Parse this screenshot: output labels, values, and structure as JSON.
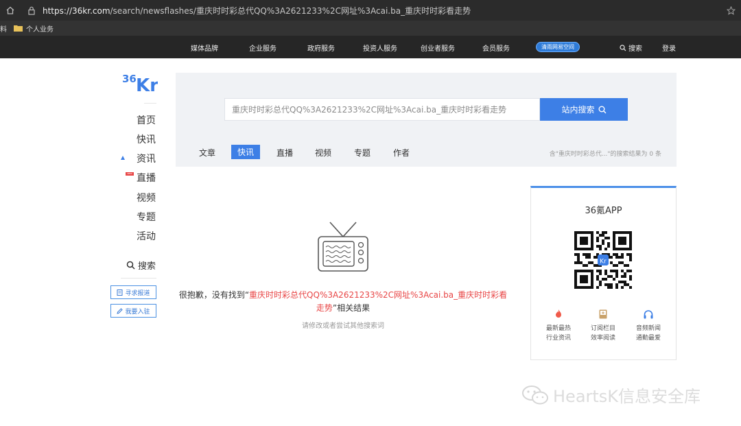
{
  "browser": {
    "url_domain": "https://36kr.com",
    "url_path": "/search/newsflashes/重庆时时彩总代QQ%3A2621233%2C网址%3Acai.ba_重庆时时彩看走势",
    "bookmark_cut": "料",
    "bookmark_folder": "个人业务"
  },
  "site_nav": {
    "items": [
      "媒体品牌",
      "企业服务",
      "政府服务",
      "投资人服务",
      "创业者服务",
      "会员服务"
    ],
    "badge": "清雨网易空间",
    "search": "搜索",
    "login": "登录"
  },
  "sidebar": {
    "logo_text": "36Kr",
    "items": [
      "首页",
      "快讯",
      "资讯",
      "直播",
      "视频",
      "专题",
      "活动"
    ],
    "hot_badge": "NEW",
    "search": "搜索",
    "btn_report": "寻求报道",
    "btn_join": "我要入驻"
  },
  "search": {
    "query": "重庆时时彩总代QQ%3A2621233%2C网址%3Acai.ba_重庆时时彩看走势",
    "button": "站内搜索",
    "tabs": [
      "文章",
      "快讯",
      "直播",
      "视频",
      "专题",
      "作者"
    ],
    "active_tab": "快讯",
    "result_count": "含\"重庆时时彩总代...\"的搜索结果为 0 条"
  },
  "empty": {
    "prefix": "很抱歉，没有找到“",
    "keyword": "重庆时时彩总代QQ%3A2621233%2C网址%3Acai.ba_重庆时时彩看走势",
    "suffix": "”相关结果",
    "hint": "请修改或者尝试其他搜索词"
  },
  "app_card": {
    "title": "36氪APP",
    "features": [
      {
        "icon": "flame-icon",
        "line1": "最新最热",
        "line2": "行业资讯"
      },
      {
        "icon": "book-icon",
        "line1": "订阅栏目",
        "line2": "效率阅读"
      },
      {
        "icon": "headphones-icon",
        "line1": "音频新闻",
        "line2": "通勤最爱"
      }
    ]
  },
  "watermark": {
    "text": "HeartsK信息安全库"
  },
  "colors": {
    "accent": "#3d7fe6",
    "keyword": "#e84545",
    "nav_bg": "#262626"
  }
}
